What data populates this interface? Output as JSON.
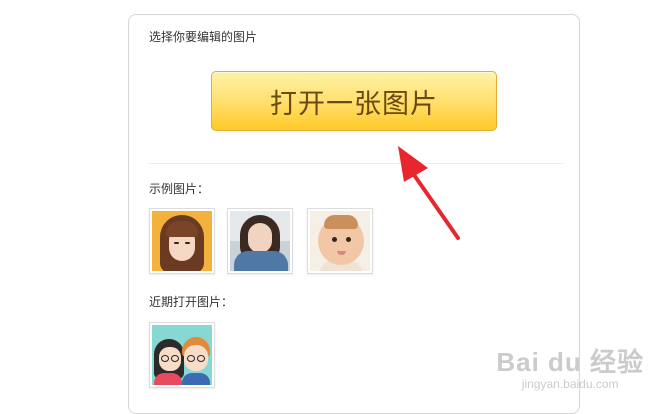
{
  "panel": {
    "choose_title": "选择你要编辑的图片",
    "open_button": "打开一张图片",
    "samples_title": "示例图片：",
    "recent_title": "近期打开图片："
  },
  "samples": [
    {
      "icon": "portrait-girl-bangs"
    },
    {
      "icon": "portrait-woman-denim"
    },
    {
      "icon": "portrait-baby"
    }
  ],
  "recent": [
    {
      "icon": "cartoon-couple"
    }
  ],
  "annotation": {
    "arrow_color": "#e8262d"
  },
  "watermark": {
    "brand": "Bai du 经验",
    "url": "jingyan.baidu.com"
  },
  "colors": {
    "button_top": "#fff2a6",
    "button_bottom": "#ffc928",
    "button_text": "#6b4a10",
    "panel_border": "#d7d7d7"
  }
}
